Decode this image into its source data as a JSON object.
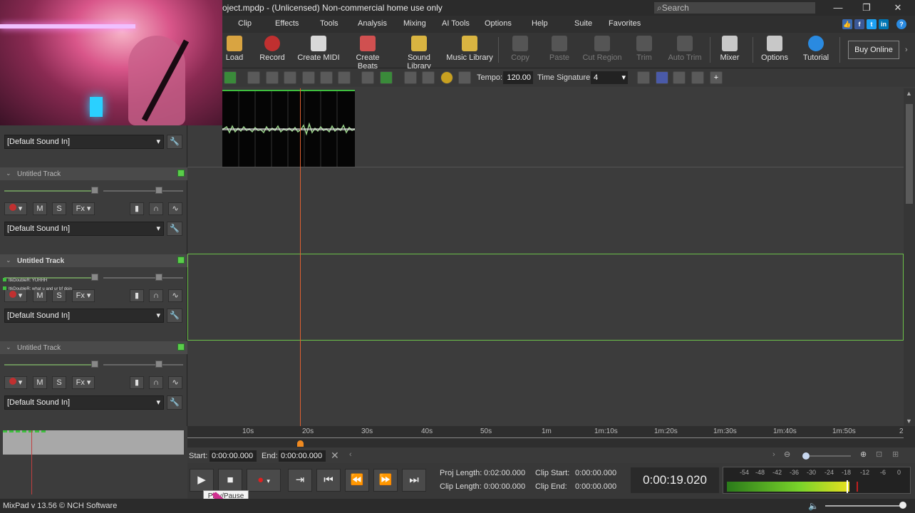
{
  "window": {
    "title": "oject.mpdp - (Unlicensed) Non-commercial home use only",
    "search_placeholder": "Search"
  },
  "menu": [
    "Clip",
    "Effects",
    "Tools",
    "Analysis",
    "Mixing",
    "AI Tools",
    "Options",
    "Help",
    "Suite",
    "Favorites"
  ],
  "toolbar": {
    "items": [
      {
        "label": "Load",
        "icon": "folder-icon",
        "enabled": true,
        "color": "#d9a441"
      },
      {
        "label": "Record",
        "icon": "record-icon",
        "enabled": true,
        "color": "#c03030"
      },
      {
        "label": "Create MIDI",
        "icon": "midi-icon",
        "enabled": true,
        "color": "#d8d8d8"
      },
      {
        "label": "Create Beats",
        "icon": "drums-icon",
        "enabled": true,
        "color": "#d05050"
      },
      {
        "label": "Sound Library",
        "icon": "sound-library-icon",
        "enabled": true,
        "color": "#d9b441"
      },
      {
        "label": "Music Library",
        "icon": "music-library-icon",
        "enabled": true,
        "color": "#d9b441"
      },
      {
        "label": "Copy",
        "icon": "copy-icon",
        "enabled": false
      },
      {
        "label": "Paste",
        "icon": "paste-icon",
        "enabled": false
      },
      {
        "label": "Cut Region",
        "icon": "cut-region-icon",
        "enabled": false
      },
      {
        "label": "Trim",
        "icon": "trim-icon",
        "enabled": false
      },
      {
        "label": "Auto Trim",
        "icon": "auto-trim-icon",
        "enabled": false
      },
      {
        "label": "Mixer",
        "icon": "mixer-icon",
        "enabled": true,
        "color": "#c8c8c8"
      },
      {
        "label": "Options",
        "icon": "options-icon",
        "enabled": true,
        "color": "#c8c8c8"
      },
      {
        "label": "Tutorial",
        "icon": "tutorial-icon",
        "enabled": true,
        "color": "#2a8ae0"
      }
    ],
    "buy_online": "Buy Online"
  },
  "toolbar2": {
    "tempo_label": "Tempo:",
    "tempo_value": "120.00",
    "time_signature_label": "Time Signature:",
    "time_signature_value": "4"
  },
  "tracks": [
    {
      "name": "",
      "sound_in": "[Default Sound In]"
    },
    {
      "name": "Untitled Track",
      "sound_in": "[Default Sound In]"
    },
    {
      "name": "Untitled Track",
      "sound_in": "[Default Sound In]"
    },
    {
      "name": "Untitled Track",
      "sound_in": "[Default Sound In]"
    }
  ],
  "track_buttons": {
    "mute": "M",
    "solo": "S",
    "fx": "Fx"
  },
  "chat": [
    "ItkDoubleR: YUHHH",
    "ItkDoubleR: what u and ur bf doin"
  ],
  "ruler": [
    "10s",
    "20s",
    "30s",
    "40s",
    "50s",
    "1m",
    "1m:10s",
    "1m:20s",
    "1m:30s",
    "1m:40s",
    "1m:50s",
    "2"
  ],
  "range": {
    "start_label": "Start:",
    "start_value": "0:00:00.000",
    "end_label": "End:",
    "end_value": "0:00:00.000"
  },
  "info": {
    "proj_length_label": "Proj Length:",
    "proj_length_value": "0:02:00.000",
    "clip_length_label": "Clip Length:",
    "clip_length_value": "0:00:00.000",
    "clip_start_label": "Clip Start:",
    "clip_start_value": "0:00:00.000",
    "clip_end_label": "Clip End:",
    "clip_end_value": "0:00:00.000"
  },
  "time_display": "0:00:19.020",
  "meter_scale": [
    "-54",
    "-48",
    "-42",
    "-36",
    "-30",
    "-24",
    "-18",
    "-12",
    "-6",
    "0"
  ],
  "tooltip": "Play/Pause",
  "status": "MixPad v 13.56 © NCH Software"
}
